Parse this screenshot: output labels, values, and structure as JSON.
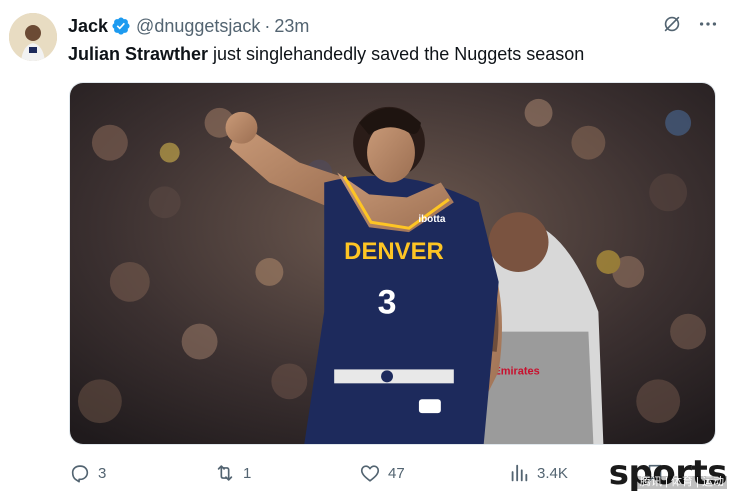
{
  "tweet": {
    "author_name": "Jack",
    "handle": "@dnuggetsjack",
    "separator": "·",
    "time_ago": "23m",
    "text_mention": "Julian Strawther",
    "text_rest": " just singlehandedly saved the Nuggets season",
    "verified_icon": "verified-badge-icon",
    "verified_color": "#1d9bf0"
  },
  "header_actions": {
    "grok_icon": "grok-icon",
    "more_icon": "more-icon"
  },
  "media": {
    "jersey_team": "DENVER",
    "jersey_number": "3",
    "jersey_sponsor": "ibotta",
    "jersey_color": "#1d2a5c",
    "jersey_text_color": "#fec524",
    "referee_patch": "Emirates"
  },
  "actions": {
    "reply_count": "3",
    "retweet_count": "1",
    "like_count": "47",
    "view_count": "3.4K",
    "icon_color": "#536471"
  },
  "watermark": {
    "main": "sports",
    "sub": "腾讯 | 体育 | 运动"
  }
}
